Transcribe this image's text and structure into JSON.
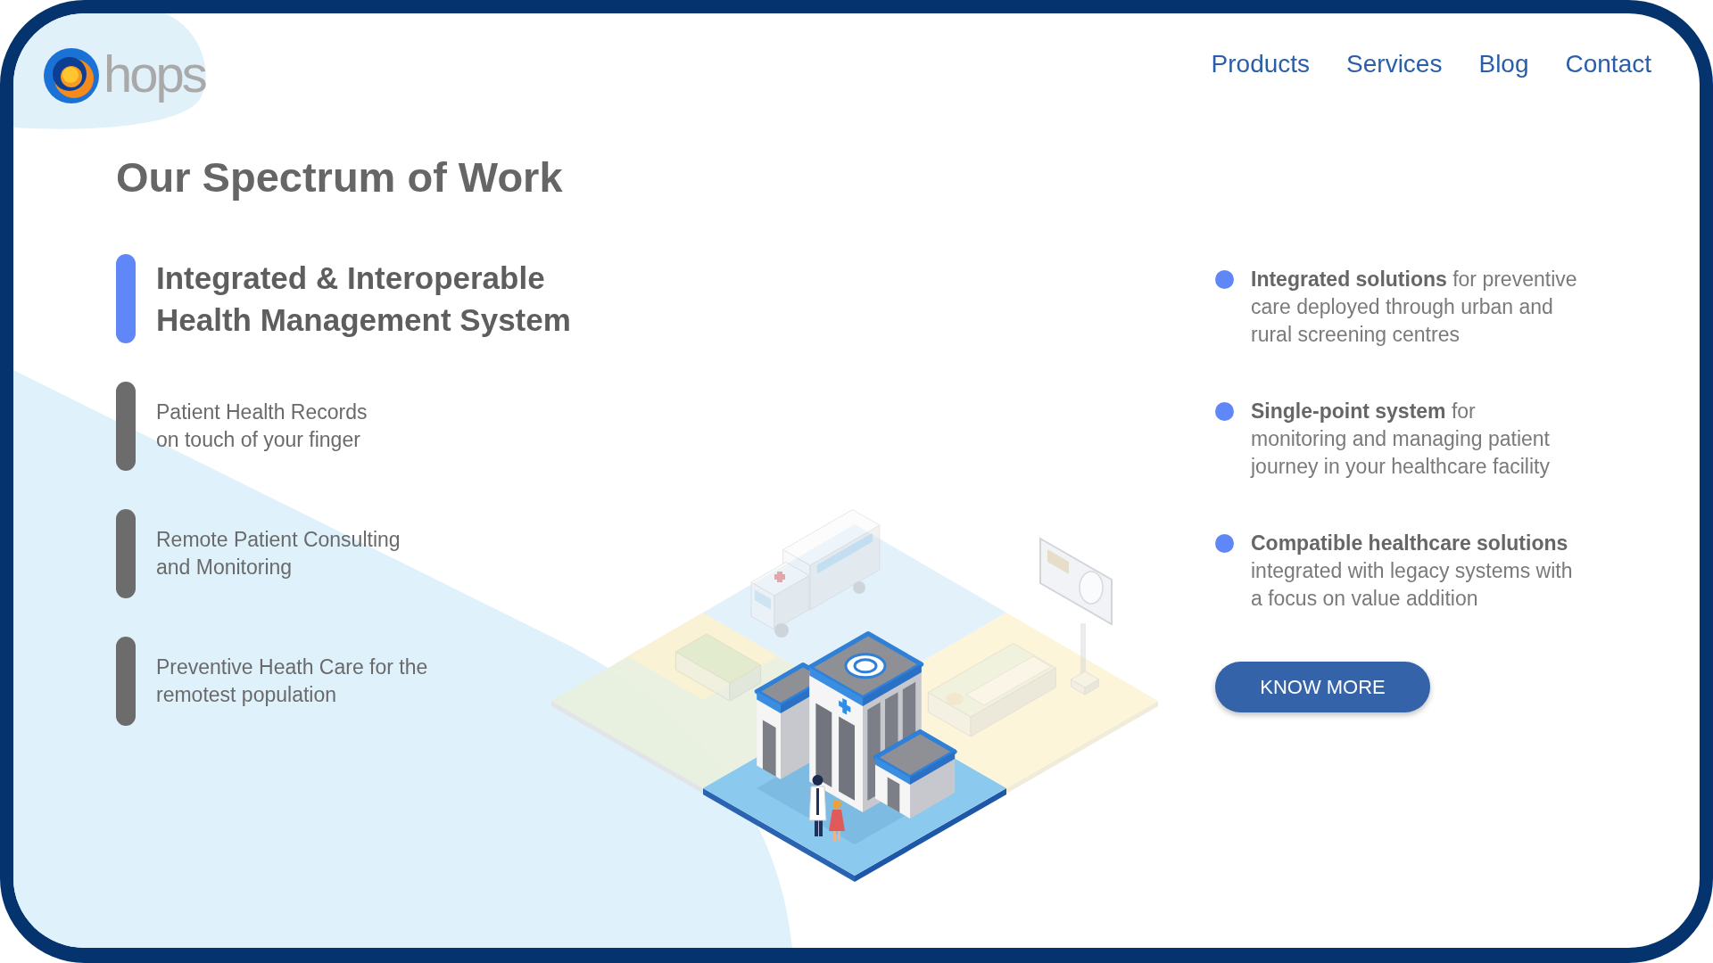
{
  "logo": {
    "name": "hops"
  },
  "nav": [
    {
      "label": "Products"
    },
    {
      "label": "Services"
    },
    {
      "label": "Blog"
    },
    {
      "label": "Contact"
    }
  ],
  "heading": "Our Spectrum of Work",
  "work_areas": [
    {
      "lines": [
        "Integrated & Interoperable",
        "Health Management System"
      ],
      "selected": true
    },
    {
      "lines": [
        "Patient Health Records",
        "on touch of your finger"
      ],
      "selected": false
    },
    {
      "lines": [
        "Remote Patient Consulting",
        "and Monitoring"
      ],
      "selected": false
    },
    {
      "lines": [
        "Preventive Heath Care for the",
        "remotest population"
      ],
      "selected": false
    }
  ],
  "highlights": [
    {
      "lines": [
        "**Integrated solutions** for preventive",
        "care deployed through urban and",
        "rural screening centres"
      ]
    },
    {
      "lines": [
        "**Single-point system** for",
        "monitoring and managing patient",
        "journey in your healthcare facility"
      ]
    },
    {
      "lines": [
        "**Compatible healthcare solutions**",
        "integrated with legacy systems with",
        "a focus on value addition"
      ]
    }
  ],
  "button": {
    "label": "KNOW MORE"
  }
}
